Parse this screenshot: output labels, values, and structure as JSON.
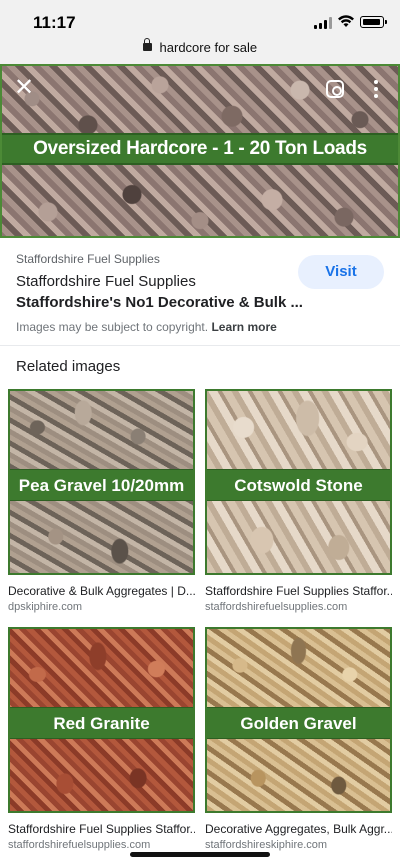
{
  "status_bar": {
    "time": "11:17"
  },
  "url_bar": {
    "text": "hardcore for sale"
  },
  "hero": {
    "banner": "Oversized Hardcore - 1 - 20 Ton Loads"
  },
  "detail": {
    "source": "Staffordshire Fuel Supplies",
    "title_line1": "Staffordshire Fuel Supplies",
    "title_line2": "Staffordshire's No1 Decorative & Bulk ...",
    "visit_label": "Visit",
    "copyright_text": "Images may be subject to copyright.",
    "learn_more": "Learn more"
  },
  "related": {
    "heading": "Related images",
    "items": [
      {
        "label": "Pea Gravel 10/20mm",
        "title": "Decorative & Bulk Aggregates | D...",
        "site": "dpskiphire.com"
      },
      {
        "label": "Cotswold Stone",
        "title": "Staffordshire Fuel Supplies Staffor...",
        "site": "staffordshirefuelsupplies.com"
      },
      {
        "label": "Red Granite",
        "title": "Staffordshire Fuel Supplies Staffor...",
        "site": "staffordshirefuelsupplies.com"
      },
      {
        "label": "Golden Gravel",
        "title": "Decorative Aggregates, Bulk Aggr...",
        "site": "staffordshireskiphire.com"
      }
    ]
  }
}
